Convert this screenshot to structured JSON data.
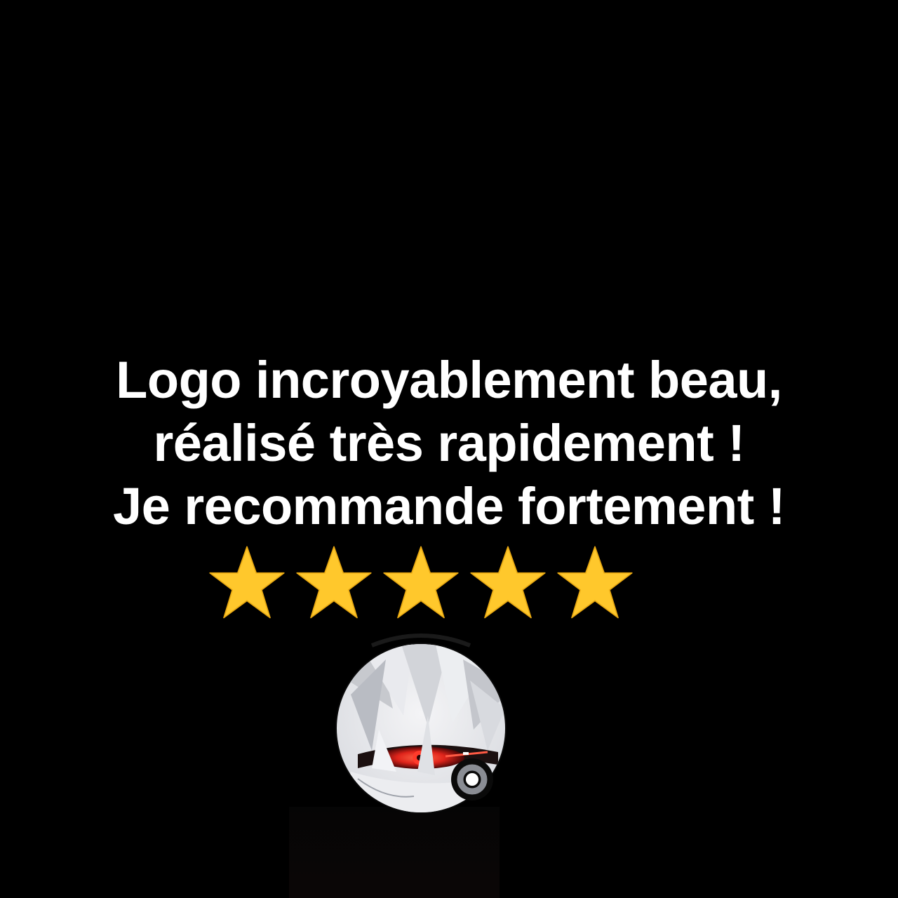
{
  "review": {
    "line1": "Logo incroyablement beau,",
    "line2": "réalisé très rapidement !",
    "line3": "Je recommande fortement !"
  },
  "rating": {
    "value": 5,
    "max": 5,
    "star_color": "#FFC82C",
    "star_icon": "star-icon"
  },
  "avatar": {
    "icon": "anime-character-avatar",
    "badge_icon": "instagram-ring-badge-icon"
  },
  "colors": {
    "background": "#000000",
    "text": "#FFFFFF",
    "eye_accent": "#E0241B",
    "badge_ring": "#8A8D94"
  }
}
